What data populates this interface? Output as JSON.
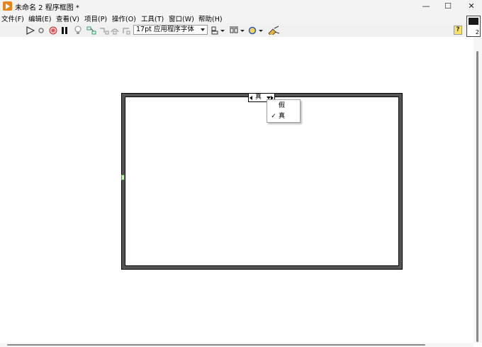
{
  "window": {
    "title": "未命名 2 程序框图 *",
    "minimize": "—",
    "maximize": "☐",
    "close": "✕"
  },
  "menu": [
    "文件(F)",
    "编辑(E)",
    "查看(V)",
    "项目(P)",
    "操作(O)",
    "工具(T)",
    "窗口(W)",
    "帮助(H)"
  ],
  "toolbar": {
    "font_select": "17pt 应用程序字体",
    "help_icon": "?",
    "vi_icon_number": "2"
  },
  "case_structure": {
    "selector_value": "真",
    "options": [
      {
        "label": "假",
        "checked": false
      },
      {
        "label": "真",
        "checked": true
      }
    ],
    "check_mark": "✓"
  },
  "colors": {
    "app_icon": "#e8841c",
    "case_border": "#555555",
    "selector_terminal": "#3c9a2a"
  }
}
